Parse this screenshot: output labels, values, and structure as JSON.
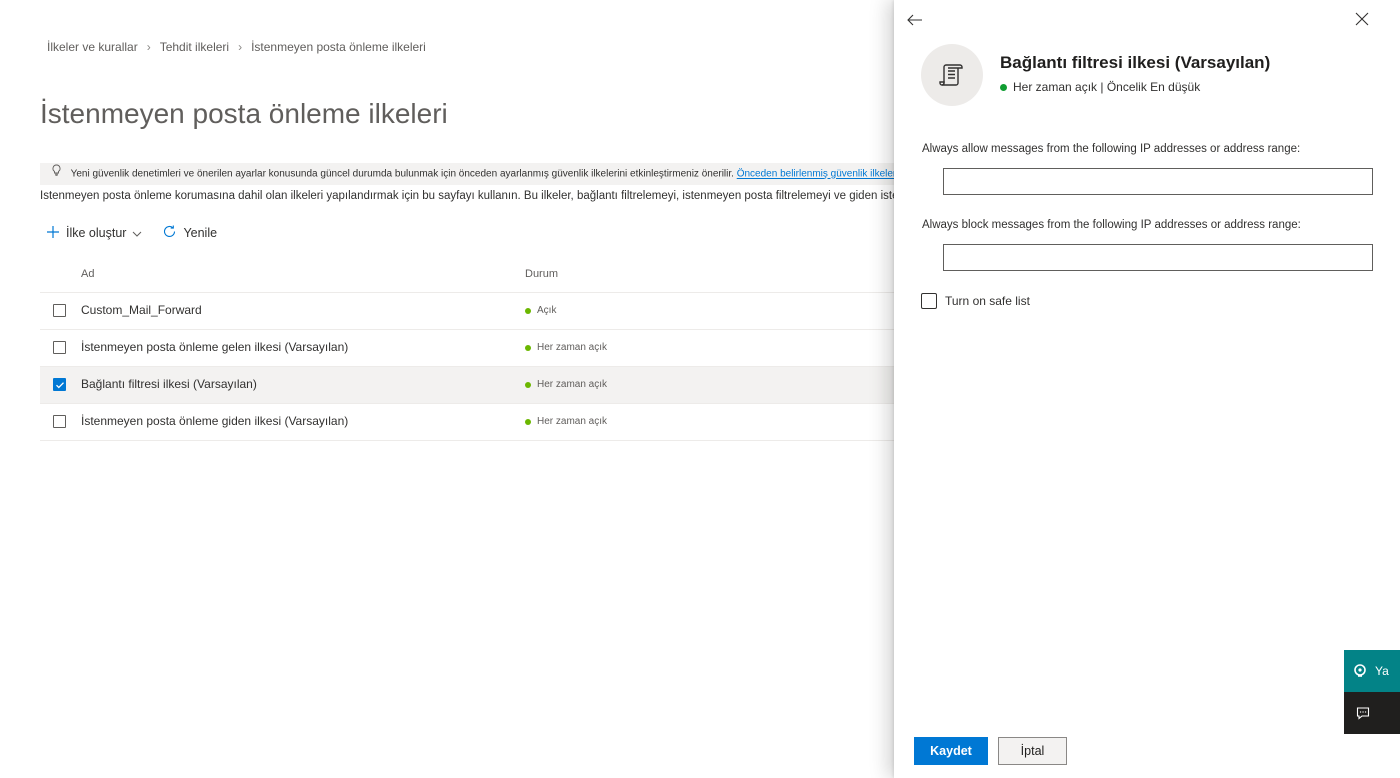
{
  "breadcrumb": {
    "items": [
      "İlkeler ve kurallar",
      "Tehdit ilkeleri",
      "İstenmeyen posta önleme ilkeleri"
    ]
  },
  "page": {
    "title": "İstenmeyen posta önleme ilkeleri",
    "info_text": "Yeni güvenlik denetimleri ve önerilen ayarlar konusunda güncel durumda bulunmak için önceden ayarlanmış güvenlik ilkelerini etkinleştirmeniz önerilir.",
    "info_link": "Önceden belirlenmiş güvenlik ilkeleri",
    "description": "İstenmeyen posta önleme korumasına dahil olan ilkeleri yapılandırmak için bu sayfayı kullanın. Bu ilkeler, bağlantı filtrelemeyi, istenmeyen posta filtrelemeyi ve giden istenmeyen posta filtrelemeyi içerir."
  },
  "toolbar": {
    "create_label": "İlke oluştur",
    "refresh_label": "Yenile"
  },
  "table": {
    "columns": {
      "name": "Ad",
      "status": "Durum"
    },
    "rows": [
      {
        "name": "Custom_Mail_Forward",
        "status": "Açık",
        "checked": false
      },
      {
        "name": "İstenmeyen posta önleme gelen ilkesi (Varsayılan)",
        "status": "Her zaman açık",
        "checked": false
      },
      {
        "name": "Bağlantı filtresi ilkesi (Varsayılan)",
        "status": "Her zaman açık",
        "checked": true
      },
      {
        "name": "İstenmeyen posta önleme giden ilkesi (Varsayılan)",
        "status": "Her zaman açık",
        "checked": false
      }
    ]
  },
  "panel": {
    "title": "Bağlantı filtresi ilkesi (Varsayılan)",
    "subtitle": "Her zaman açık | Öncelik En düşük",
    "allow_label": "Always allow messages from the following IP addresses or address range:",
    "allow_value": "",
    "block_label": "Always block messages from the following IP addresses or address range:",
    "block_value": "",
    "safe_list_label": "Turn on safe list",
    "safe_list_checked": false,
    "save_label": "Kaydet",
    "cancel_label": "İptal"
  },
  "floating": {
    "help_label": "Ya"
  },
  "colors": {
    "accent": "#0078d4",
    "status_green": "#6bb700",
    "help_teal": "#038387"
  },
  "icons": [
    "lightbulb-icon",
    "add-icon",
    "chevron-down-icon",
    "refresh-icon",
    "checkmark-icon",
    "back-arrow-icon",
    "close-icon",
    "policy-scroll-icon",
    "help-icon",
    "feedback-icon"
  ]
}
